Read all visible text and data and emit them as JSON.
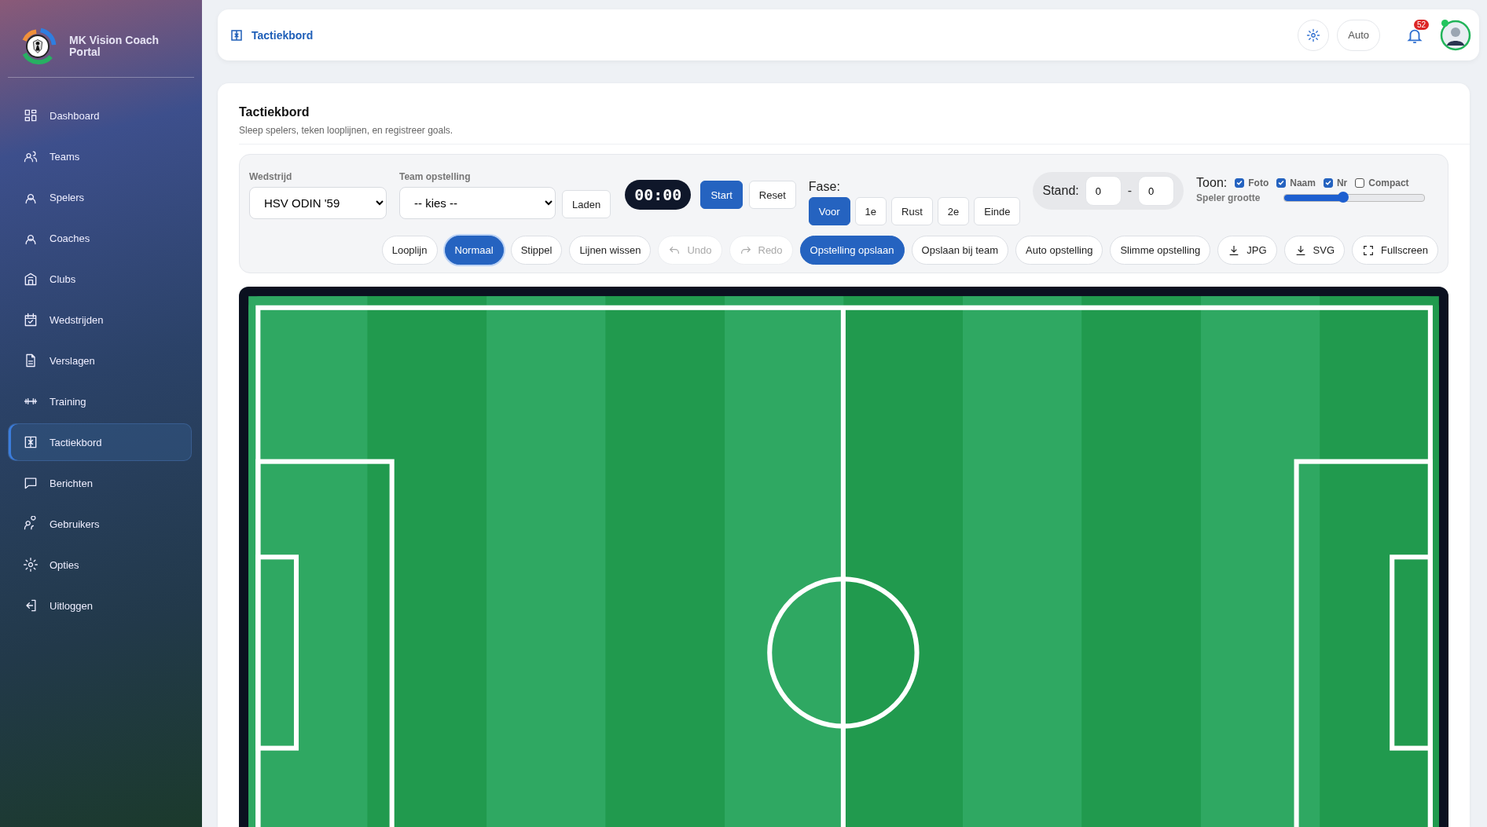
{
  "sidebar": {
    "brand": "MK Vision Coach Portal",
    "items": [
      {
        "label": "Dashboard",
        "selected": false
      },
      {
        "label": "Teams",
        "selected": false
      },
      {
        "label": "Spelers",
        "selected": false
      },
      {
        "label": "Coaches",
        "selected": false
      },
      {
        "label": "Clubs",
        "selected": false
      },
      {
        "label": "Wedstrijden",
        "selected": false
      },
      {
        "label": "Verslagen",
        "selected": false
      },
      {
        "label": "Training",
        "selected": false
      },
      {
        "label": "Tactiekbord",
        "selected": true
      },
      {
        "label": "Berichten",
        "selected": false
      },
      {
        "label": "Gebruikers",
        "selected": false
      },
      {
        "label": "Opties",
        "selected": false
      },
      {
        "label": "Uitloggen",
        "selected": false
      }
    ]
  },
  "header": {
    "title": "Tactiekbord",
    "theme_mode": "Auto",
    "notifications": "52",
    "user_online": true
  },
  "card": {
    "title": "Tactiekbord",
    "subtitle": "Sleep spelers, teken looplijnen, en registreer goals.",
    "match": {
      "label": "Wedstrijd",
      "value": "HSV ODIN '59"
    },
    "lineup": {
      "label": "Team opstelling",
      "value": "-- kies --"
    },
    "load_button": "Laden",
    "timer": "00:00",
    "start_button": "Start",
    "reset_button": "Reset",
    "phase": {
      "label": "Fase:",
      "options": [
        {
          "label": "Voor",
          "selected": true
        },
        {
          "label": "1e",
          "selected": false
        },
        {
          "label": "Rust",
          "selected": false
        },
        {
          "label": "2e",
          "selected": false
        },
        {
          "label": "Einde",
          "selected": false
        }
      ]
    },
    "score": {
      "label": "Stand:",
      "home": "0",
      "separator": "-",
      "away": "0"
    },
    "show": {
      "label": "Toon:",
      "options": [
        {
          "label": "Foto",
          "checked": true
        },
        {
          "label": "Naam",
          "checked": true
        },
        {
          "label": "Nr",
          "checked": true
        },
        {
          "label": "Compact",
          "checked": false
        }
      ]
    },
    "player_size": {
      "label": "Speler grootte",
      "level": 0.42
    },
    "tools": [
      {
        "label": "Looplijn",
        "kind": "text",
        "selected": false,
        "disabled": false
      },
      {
        "label": "Normaal",
        "kind": "text",
        "selected": true,
        "disabled": false
      },
      {
        "label": "Stippel",
        "kind": "text",
        "selected": false,
        "disabled": false
      },
      {
        "label": "Lijnen wissen",
        "kind": "text",
        "selected": false,
        "disabled": false
      },
      {
        "label": "Undo",
        "kind": "undo",
        "selected": false,
        "disabled": true
      },
      {
        "label": "Redo",
        "kind": "redo",
        "selected": false,
        "disabled": true
      },
      {
        "label": "Opstelling opslaan",
        "kind": "primary",
        "selected": false,
        "disabled": false
      },
      {
        "label": "Opslaan bij team",
        "kind": "text",
        "selected": false,
        "disabled": false
      },
      {
        "label": "Auto opstelling",
        "kind": "text",
        "selected": false,
        "disabled": false
      },
      {
        "label": "Slimme opstelling",
        "kind": "text",
        "selected": false,
        "disabled": false
      },
      {
        "label": "JPG",
        "kind": "download",
        "selected": false,
        "disabled": false
      },
      {
        "label": "SVG",
        "kind": "download",
        "selected": false,
        "disabled": false
      },
      {
        "label": "Fullscreen",
        "kind": "fullscreen",
        "selected": false,
        "disabled": false
      }
    ]
  }
}
